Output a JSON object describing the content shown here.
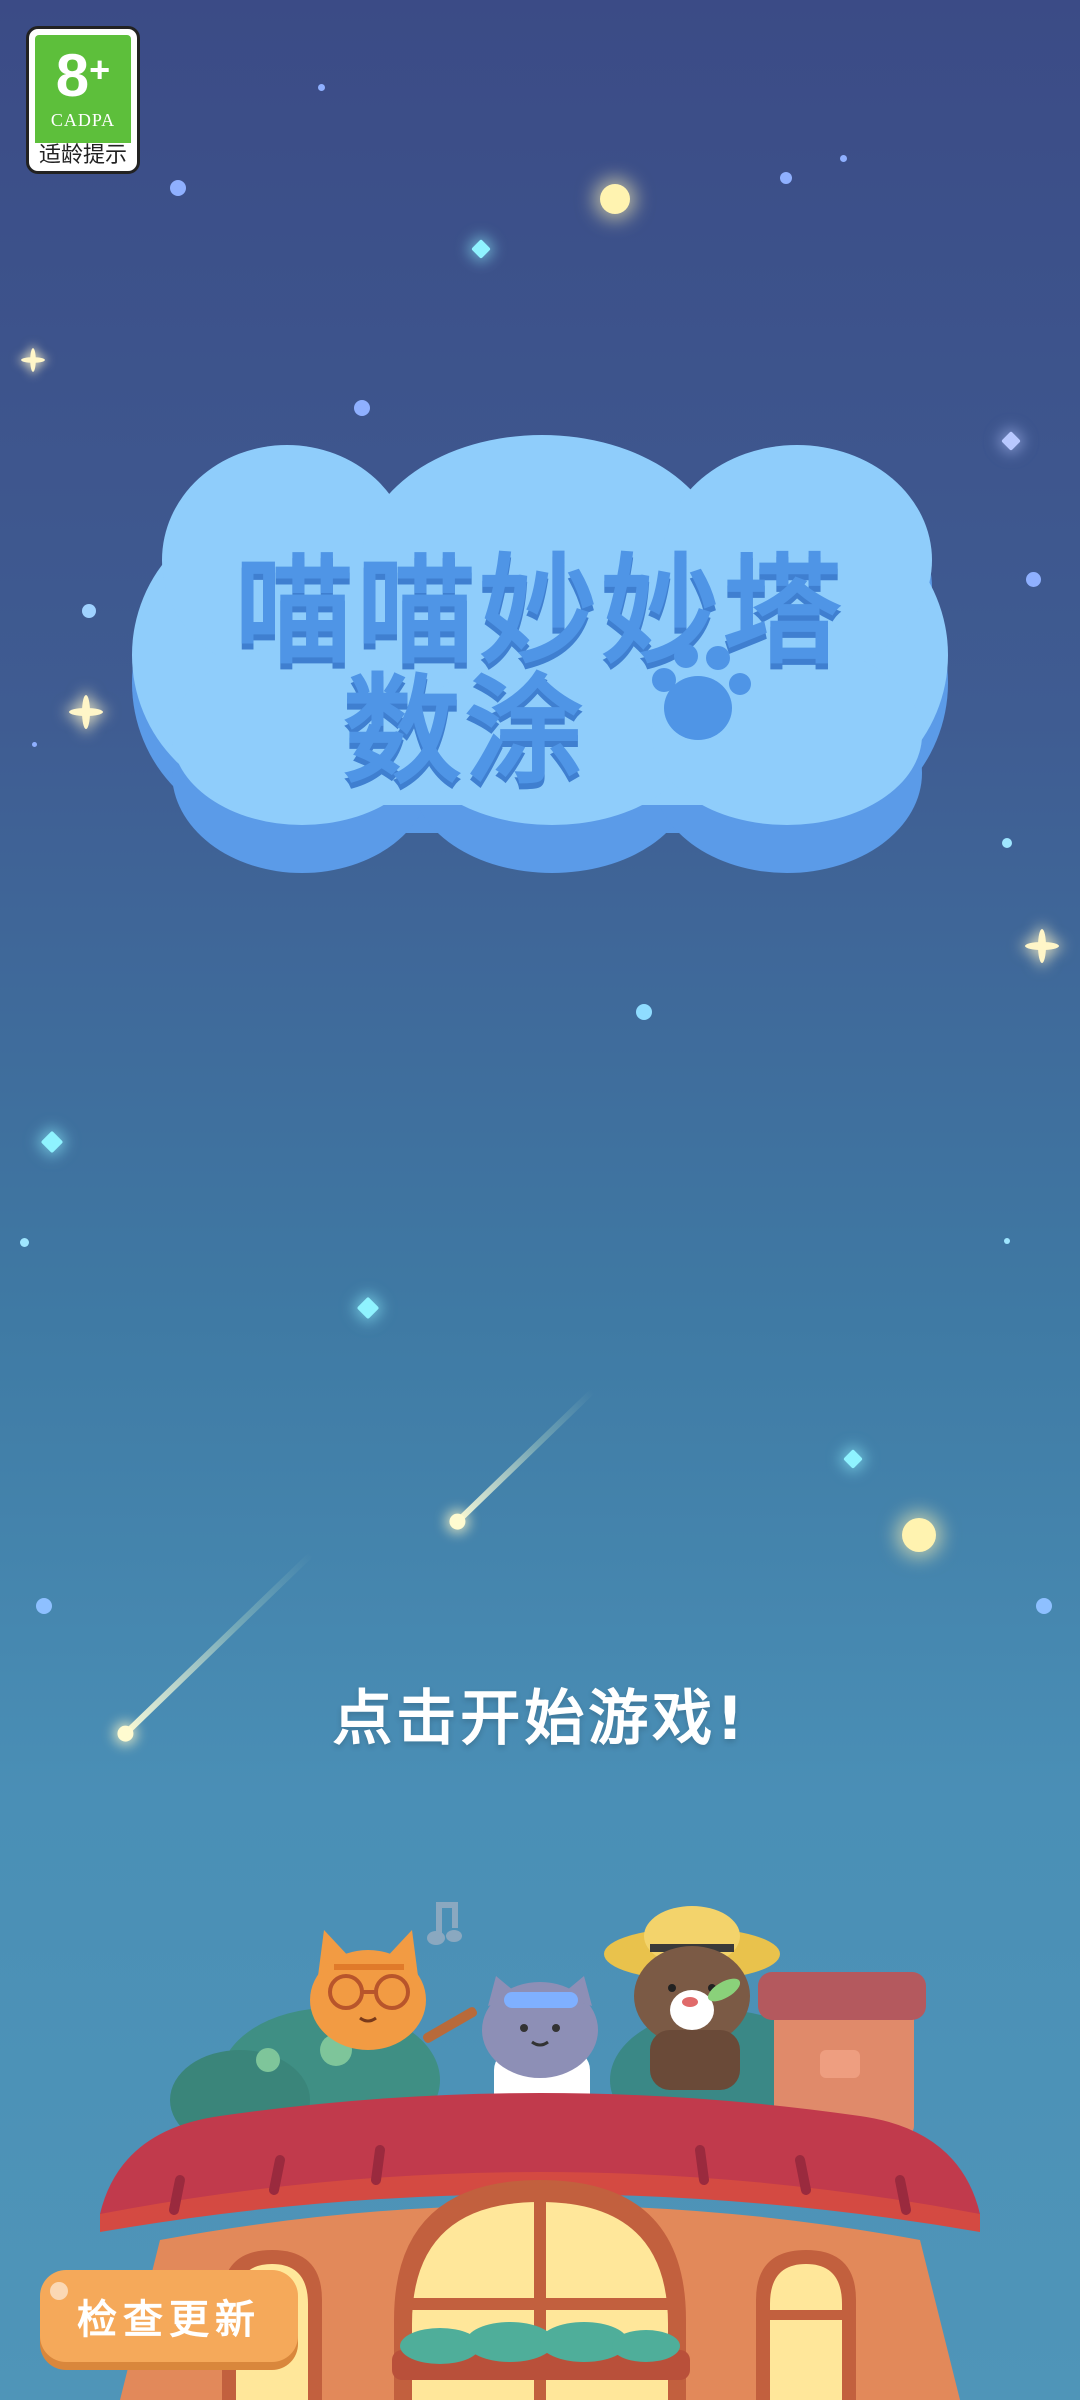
{
  "age_rating": {
    "age": "8",
    "plus": "+",
    "org": "CADPA",
    "tip": "适龄提示",
    "color": "#5dbf3b"
  },
  "logo": {
    "line1": "喵喵妙妙塔",
    "line2": "数涂",
    "icon": "paw-icon",
    "text_color": "#4f95e6",
    "cloud_color": "#8fcdfb"
  },
  "start_prompt": "点击开始游戏!",
  "update_button": {
    "label": "检查更新",
    "color": "#f5a95a"
  },
  "icons": [
    "music-note-icon",
    "star-icon",
    "sparkle-icon",
    "meteor-icon"
  ]
}
